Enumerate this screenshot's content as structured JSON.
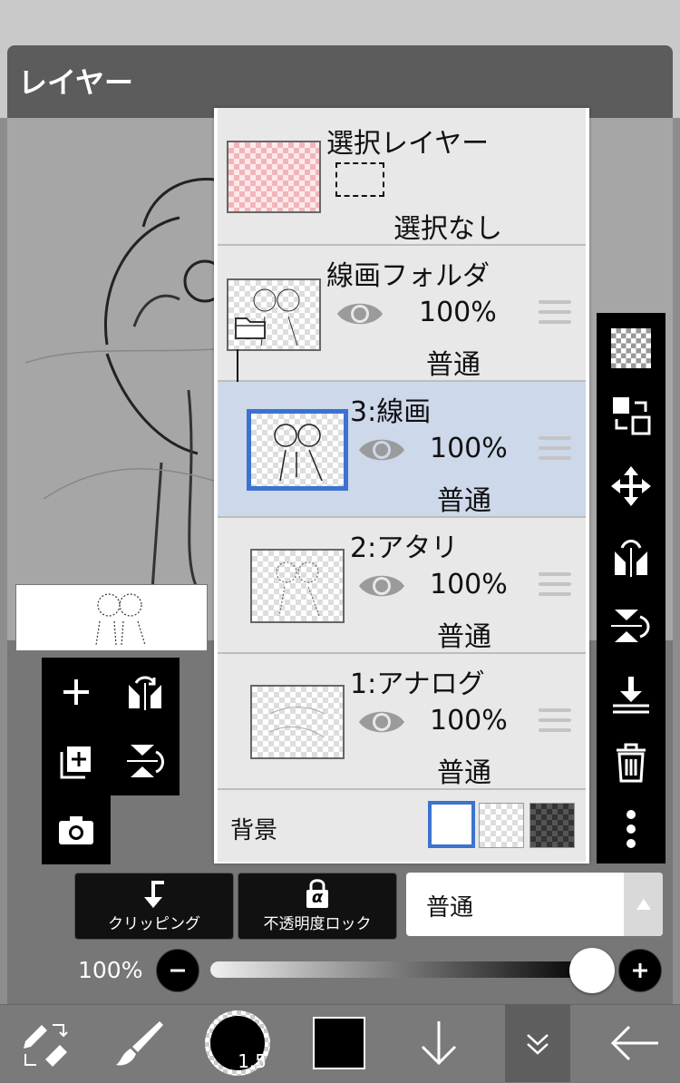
{
  "title": "レイヤー",
  "selection_layer": {
    "name": "選択レイヤー",
    "status": "選択なし"
  },
  "layers": [
    {
      "name": "線画フォルダ",
      "opacity": "100%",
      "mode": "普通"
    },
    {
      "name": "3:線画",
      "opacity": "100%",
      "mode": "普通"
    },
    {
      "name": "2:アタリ",
      "opacity": "100%",
      "mode": "普通"
    },
    {
      "name": "1:アナログ",
      "opacity": "100%",
      "mode": "普通"
    }
  ],
  "background": {
    "label": "背景"
  },
  "buttons": {
    "clipping": "クリッピング",
    "alpha_lock": "不透明度ロック",
    "alpha_symbol": "α"
  },
  "blend_mode": {
    "selected": "普通"
  },
  "opacity_slider": {
    "label": "100%",
    "value": 1.0
  },
  "brush_size": "1.5",
  "colors": {
    "selected_blue": "#3c72d0",
    "selected_row": "#cdd8ea",
    "primary_color": "#000000"
  }
}
